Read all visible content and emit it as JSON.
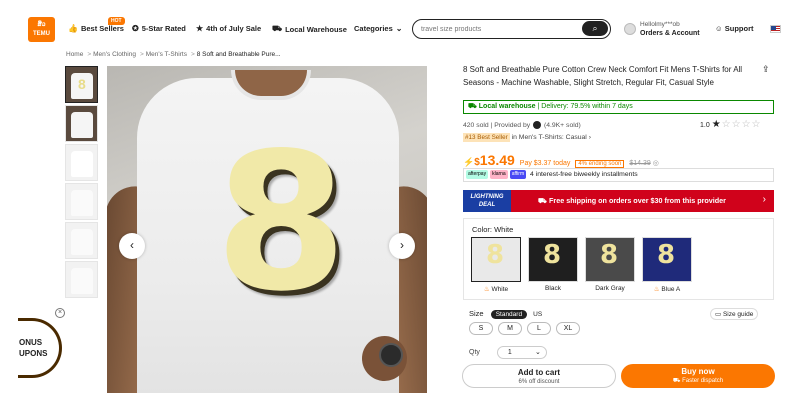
{
  "header": {
    "logo_line1": "ສີ່ວ",
    "logo_line2": "TEMU",
    "nav": [
      {
        "label": "Best Sellers",
        "icon": "thumbs-up-icon"
      },
      {
        "label": "5-Star Rated",
        "icon": "star-rated-icon"
      },
      {
        "label": "4th of July Sale",
        "icon": "star-icon"
      },
      {
        "label": "Local Warehouse",
        "icon": "truck-icon"
      },
      {
        "label": "Categories",
        "icon": "chevron-down-icon"
      }
    ],
    "hot_badge": "HOT",
    "search_placeholder": "travel size products",
    "account_greeting": "Hellolmy***ob",
    "account_label": "Orders & Account",
    "support_label": "Support"
  },
  "breadcrumb": [
    "Home",
    "Men's Clothing",
    "Men's T-Shirts",
    "8 Soft and Breathable Pure..."
  ],
  "product": {
    "title": "8 Soft and Breathable Pure Cotton Crew Neck Comfort Fit Mens T-Shirts for All Seasons - Machine Washable, Slight Stretch, Regular Fit, Casual Style",
    "main_glyph": "8",
    "local_warehouse": "Local warehouse",
    "delivery": "Delivery: 79.5% within 7 days",
    "sold": "420 sold",
    "provided_by": "Provided by",
    "seller_sold": "(4.9K+ sold)",
    "rating": "1.0",
    "stars_filled": 1,
    "stars_total": 5,
    "best_seller_badge": "#13 Best Seller",
    "best_seller_text": "in Men's T-Shirts: Casual",
    "price": "13.49",
    "currency": "$",
    "pay_note": "Pay $3.37 today",
    "ending_soon": "4% ending soon",
    "original_price": "$14.39",
    "bnpl_logos": [
      "afterpay",
      "klarna",
      "affirm"
    ],
    "bnpl_text": "4 interest-free biweekly installments",
    "lightning_line1": "LIGHTNING",
    "lightning_line2": "DEAL",
    "shipping_text": "Free shipping on orders over $30 from this provider",
    "color_label": "Color: White",
    "colors": [
      {
        "name": "White",
        "hex": "#f2f2f2",
        "hot": true
      },
      {
        "name": "Black",
        "hex": "#1f1f1f",
        "hot": false
      },
      {
        "name": "Dark Gray",
        "hex": "#4a4a4a",
        "hot": false
      },
      {
        "name": "Blue A",
        "hex": "#1f2a7a",
        "hot": true
      }
    ],
    "size_label": "Size",
    "size_standard": "Standard",
    "size_us": "US",
    "size_guide": "Size guide",
    "sizes": [
      "S",
      "M",
      "L",
      "XL"
    ],
    "qty_label": "Qty",
    "qty_value": "1",
    "add_to_cart": "Add to cart",
    "cart_discount": "6% off discount",
    "buy_now": "Buy now",
    "fast_dispatch": "Faster dispatch"
  },
  "coupon": {
    "line1": "ONUS",
    "line2": "UPONS"
  },
  "colors": {
    "brand": "#fb7701",
    "green": "#0a8800",
    "red_bar": "#d0021b",
    "lightning_blue": "#1a3ea3"
  }
}
